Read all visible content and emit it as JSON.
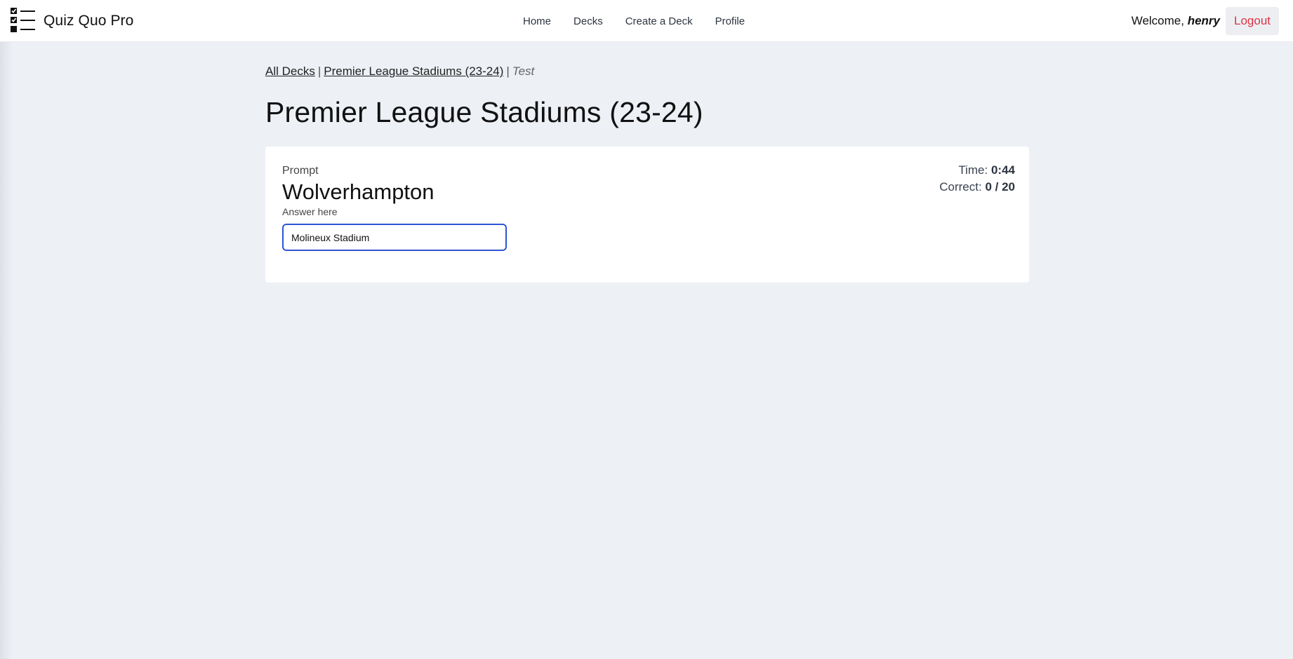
{
  "app": {
    "brand": "Quiz Quo Pro",
    "nav": [
      "Home",
      "Decks",
      "Create a Deck",
      "Profile"
    ],
    "welcome_prefix": "Welcome,",
    "username": "henry",
    "logout_label": "Logout",
    "brand_icon": "checklist-icon"
  },
  "breadcrumb": {
    "all_decks": "All Decks",
    "separator": "|",
    "deck": "Premier League Stadiums (23-24)",
    "current": "Test"
  },
  "page_title": "Premier League Stadiums (23-24)",
  "quiz": {
    "prompt_label": "Prompt",
    "prompt_value": "Wolverhampton",
    "answer_label": "Answer here",
    "answer_value": "Molineux Stadium",
    "time_label": "Time:",
    "time_value": "0:44",
    "correct_label": "Correct:",
    "correct_value": "0 / 20"
  },
  "colors": {
    "background": "#edf0f5",
    "logout_text": "#dc3545",
    "input_focus_border": "#2f55d4"
  }
}
